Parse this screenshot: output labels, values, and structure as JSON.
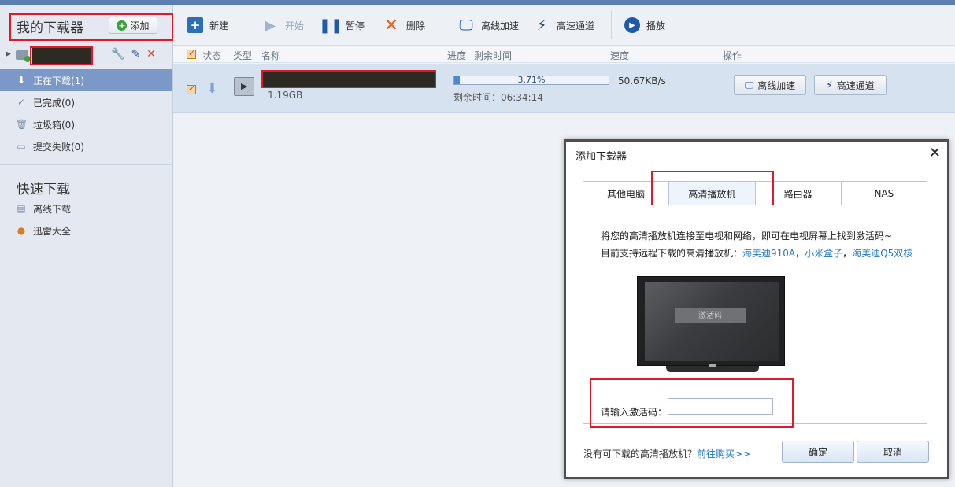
{
  "sidebar": {
    "title": "我的下载器",
    "add_label": "添加",
    "items": [
      {
        "label": "正在下载(1)",
        "icon": "download-arrow-icon"
      },
      {
        "label": "已完成(0)",
        "icon": "check-icon"
      },
      {
        "label": "垃圾箱(0)",
        "icon": "trash-icon"
      },
      {
        "label": "提交失败(0)",
        "icon": "failed-icon"
      }
    ],
    "quick_title": "快速下载",
    "quick_items": [
      {
        "label": "离线下载",
        "icon": "offline-icon"
      },
      {
        "label": "迅雷大全",
        "icon": "xunlei-icon"
      }
    ]
  },
  "toolbar": {
    "new": "新建",
    "start": "开始",
    "pause": "暂停",
    "delete": "删除",
    "offline": "离线加速",
    "highspeed": "高速通道",
    "play": "播放"
  },
  "listhead": {
    "status": "状态",
    "type": "类型",
    "name": "名称",
    "progress": "进度",
    "remaining": "剩余时间",
    "speed": "速度",
    "action": "操作"
  },
  "task": {
    "size": "1.19GB",
    "progress_text": "3.71%",
    "progress": 0.0371,
    "remaining": "剩余时间：06:34:14",
    "speed": "50.67KB/s",
    "btn_offline": "离线加速",
    "btn_highspeed": "高速通道"
  },
  "dialog": {
    "title": "添加下载器",
    "tabs": [
      "其他电脑",
      "高清播放机",
      "路由器",
      "NAS"
    ],
    "active_tab": 1,
    "desc1": "将您的高清播放机连接至电视和网络，即可在电视屏幕上找到激活码~",
    "desc2_prefix": "目前支持远程下载的高清播放机：",
    "device1": "海美迪910A",
    "comma1": "，",
    "device2": "小米盒子",
    "comma2": "，",
    "device3": "海美迪Q5双核",
    "tv_code": "激活码",
    "input_label": "请输入激活码：",
    "input_value": "",
    "foot_text": "没有可下载的高清播放机？",
    "foot_link": "前往购买>>",
    "ok": "确定",
    "cancel": "取消"
  }
}
